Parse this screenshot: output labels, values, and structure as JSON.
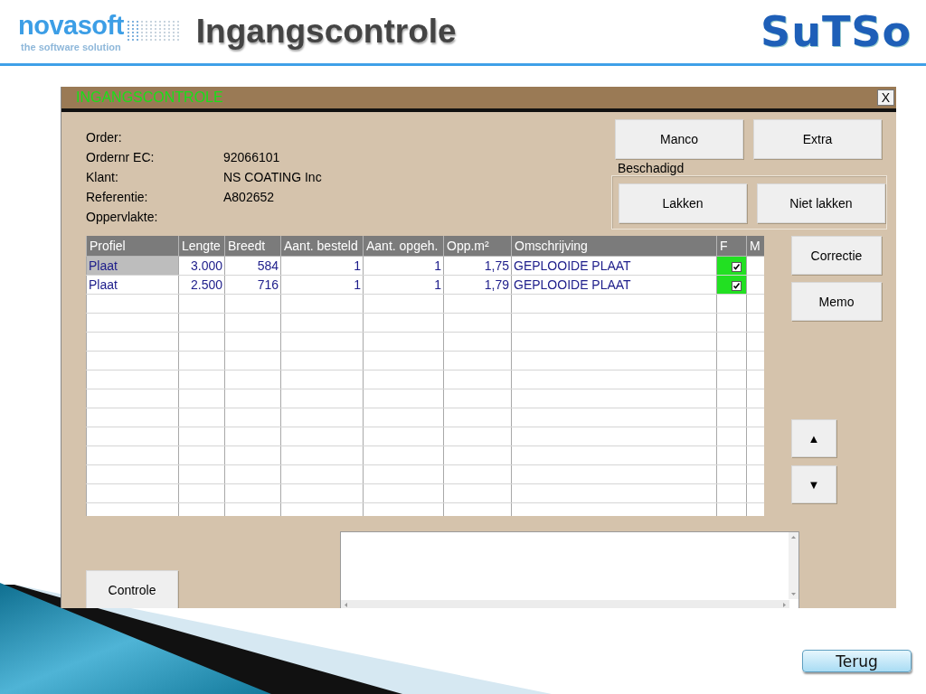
{
  "header": {
    "logo_name": "novasoft",
    "logo_tagline": "the software solution",
    "title": "Ingangscontrole",
    "brand": "SuTSo"
  },
  "window": {
    "title": "INGANGSCONTROLE",
    "close": "X"
  },
  "info": [
    {
      "label": "Order:"
    },
    {
      "label": "Ordernr EC:",
      "value": "92066101"
    },
    {
      "label": "Klant:",
      "value": "NS COATING Inc"
    },
    {
      "label": "Referentie:",
      "value": "A802652"
    },
    {
      "label": "Oppervlakte:"
    }
  ],
  "top_buttons": [
    "Manco",
    "Extra"
  ],
  "damage_group": {
    "legend": "Beschadigd",
    "buttons": [
      "Lakken",
      "Niet lakken"
    ]
  },
  "grid": {
    "columns": [
      {
        "label": "Profiel",
        "kind": "text"
      },
      {
        "label": "Lengte",
        "kind": "number"
      },
      {
        "label": "Breedt",
        "kind": "number"
      },
      {
        "label": "Aant. besteld",
        "kind": "number"
      },
      {
        "label": "Aant. opgeh.",
        "kind": "number"
      },
      {
        "label": "Opp.m²",
        "kind": "number"
      },
      {
        "label": "Omschrijving",
        "kind": "text"
      },
      {
        "label": "F",
        "kind": "check"
      },
      {
        "label": "M",
        "kind": "flag"
      }
    ],
    "rows": [
      {
        "selected": true,
        "cells": [
          "Plaat",
          "3.000",
          "584",
          "1",
          "1",
          "1,75",
          "GEPLOOIDE PLAAT"
        ],
        "f": true
      },
      {
        "selected": false,
        "cells": [
          "Plaat",
          "2.500",
          "716",
          "1",
          "1",
          "1,79",
          "GEPLOOIDE PLAAT"
        ],
        "f": true
      }
    ]
  },
  "side_buttons": [
    "Correctie",
    "Memo"
  ],
  "arrow_buttons": [
    "▲",
    "▼"
  ],
  "bottom_buttons": [
    "Controle"
  ],
  "footer": {
    "back_button": "Terug"
  }
}
